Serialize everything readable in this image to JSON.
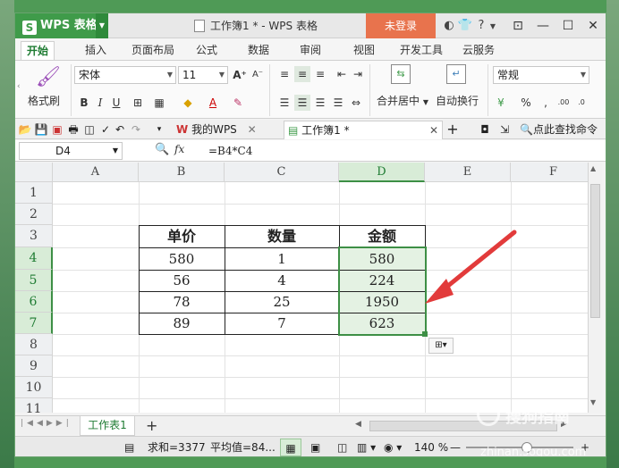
{
  "app": {
    "brand": "WPS 表格",
    "window_title": "工作簿1 * - WPS 表格",
    "login": "未登录"
  },
  "ribbon_tabs": [
    "开始",
    "插入",
    "页面布局",
    "公式",
    "数据",
    "审阅",
    "视图",
    "开发工具",
    "云服务"
  ],
  "ribbon": {
    "format_painter": "格式刷",
    "font_name": "宋体",
    "font_size": "11",
    "merge_center": "合并居中",
    "wrap_text": "自动换行",
    "number_format": "常规",
    "percent": "%"
  },
  "doc_tabs": {
    "my_wps": "我的WPS",
    "workbook": "工作簿1 *",
    "search": "点此查找命令"
  },
  "formula_bar": {
    "cell_ref": "D4",
    "fx": "fx",
    "formula": "=B4*C4"
  },
  "columns": [
    "A",
    "B",
    "C",
    "D",
    "E",
    "F"
  ],
  "rows": [
    "1",
    "2",
    "3",
    "4",
    "5",
    "6",
    "7",
    "8",
    "9",
    "10",
    "11"
  ],
  "table": {
    "headers": [
      "单价",
      "数量",
      "金额"
    ],
    "rows": [
      [
        "580",
        "1",
        "580"
      ],
      [
        "56",
        "4",
        "224"
      ],
      [
        "78",
        "25",
        "1950"
      ],
      [
        "89",
        "7",
        "623"
      ]
    ]
  },
  "sheet_tab": "工作表1",
  "status": {
    "sum": "求和=3377",
    "avg": "平均值=84...",
    "zoom": "140 %"
  },
  "watermark": {
    "text": "搜狗指南",
    "url": "zhinan.sogou.com"
  },
  "colors": {
    "accent": "#3f9b4a",
    "login": "#e8734d",
    "arrow": "#e23b3b"
  }
}
